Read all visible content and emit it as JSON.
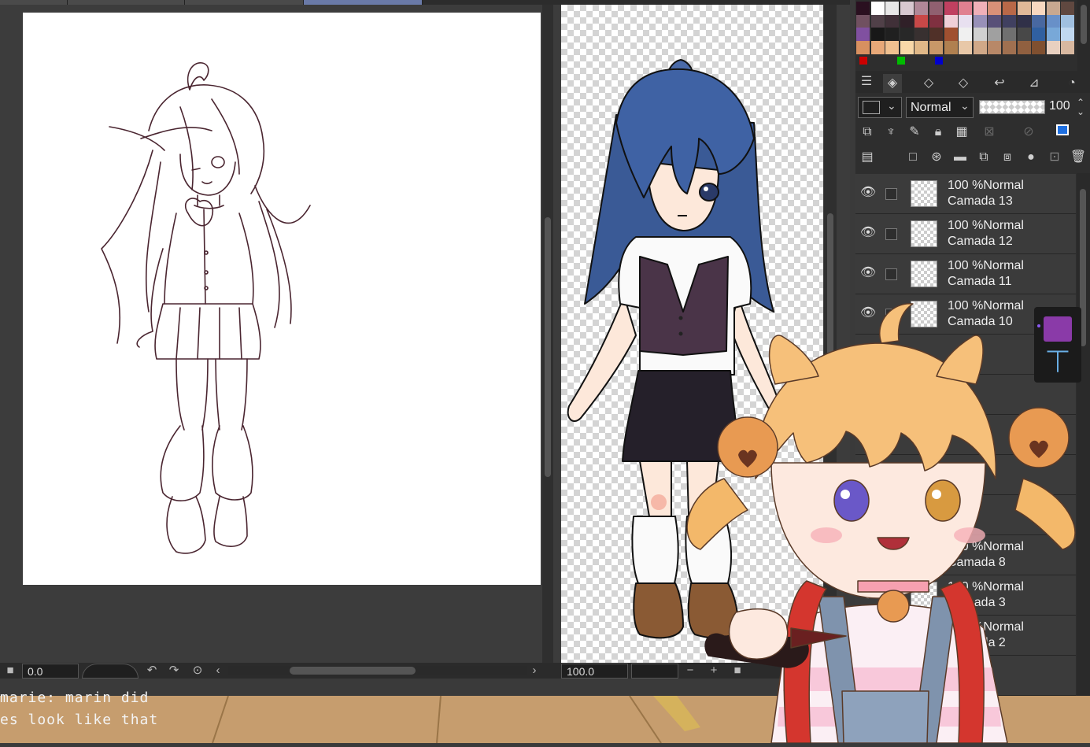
{
  "canvas_left": {
    "zoom": "0.0"
  },
  "canvas_right": {
    "zoom": "100.0"
  },
  "panel": {
    "blend_mode": "Normal",
    "opacity": "100",
    "layers": [
      {
        "opacity_mode": "100 %Normal",
        "name": "Camada 13"
      },
      {
        "opacity_mode": "100 %Normal",
        "name": "Camada 12"
      },
      {
        "opacity_mode": "100 %Normal",
        "name": "Camada 11"
      },
      {
        "opacity_mode": "100 %Normal",
        "name": "Camada 10"
      },
      {
        "opacity_mode": "100 %Normal",
        "name": "Camada 8"
      },
      {
        "opacity_mode": "100 %Normal",
        "name": "Camada 3"
      },
      {
        "opacity_mode": "100 %Normal",
        "name": "Camada 2"
      }
    ]
  },
  "palette": [
    "#2a1020",
    "#ffffff",
    "#e8e8e8",
    "#d8c8d0",
    "#b08898",
    "#906070",
    "#c04060",
    "#e08090",
    "#f0b0b8",
    "#d89078",
    "#b86848",
    "#e0b898",
    "#f8d8c0",
    "#c8a890",
    "#604840",
    "#705060",
    "#504048",
    "#403038",
    "#302028",
    "#c84848",
    "#803040",
    "#f0d0d8",
    "#e8e0f0",
    "#9890b8",
    "#585078",
    "#404060",
    "#303048",
    "#4868a0",
    "#6890c8",
    "#a0c0e0",
    "#8050a0",
    "#181818",
    "#202020",
    "#282828",
    "#383030",
    "#503028",
    "#a05030",
    "#f0f0f0",
    "#d0d0d0",
    "#a0a0a0",
    "#707070",
    "#484848",
    "#3060a0",
    "#78a8d8",
    "#c0d8f0",
    "#d89060",
    "#e8a878",
    "#f0c090",
    "#f8d8a8",
    "#e0b888",
    "#c89868",
    "#b08050",
    "#e8c8a8",
    "#d0a888",
    "#b88868",
    "#a07050",
    "#906040",
    "#805030",
    "#e8d0c0",
    "#d8b8a0"
  ],
  "rgb_swatches": [
    "#cc0000",
    "#00bb00",
    "#0000cc"
  ],
  "caption": {
    "line1": "marie: marin did",
    "line2": "es look like that"
  }
}
